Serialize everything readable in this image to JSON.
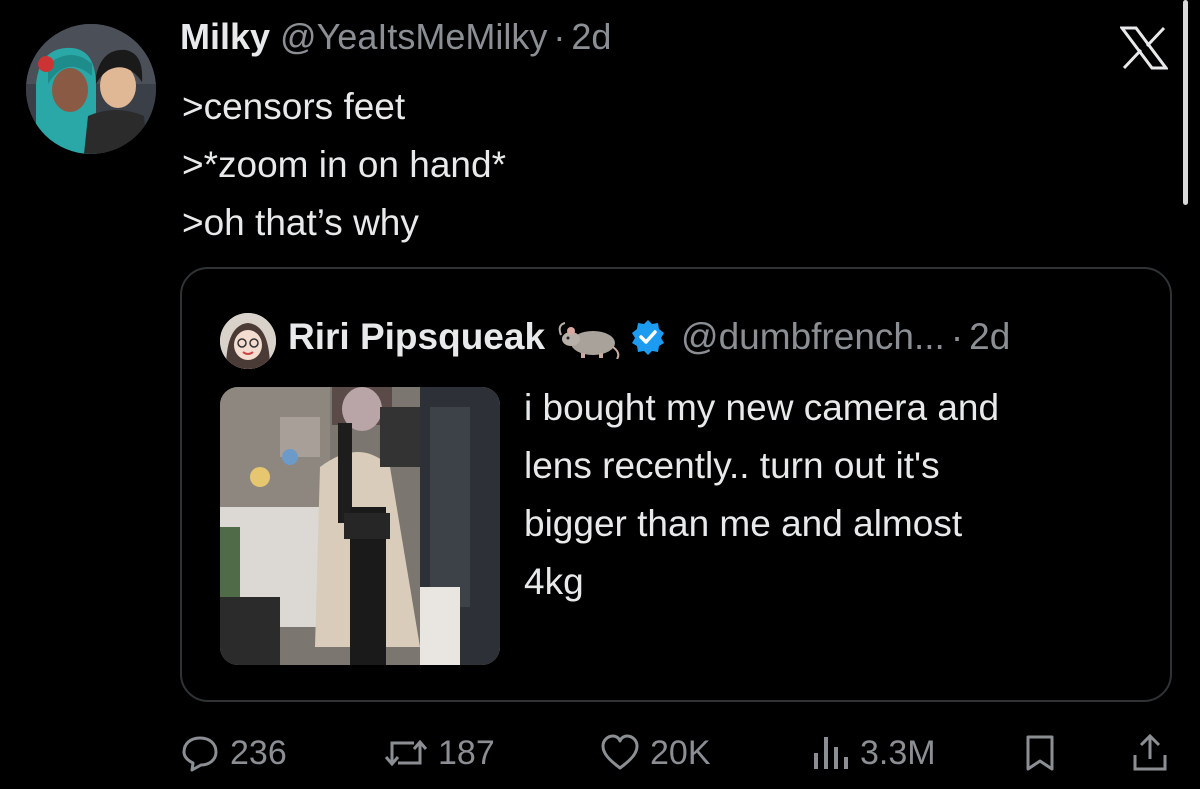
{
  "tweet": {
    "display_name": "Milky",
    "handle": "@YeaItsMeMilky",
    "separator": "·",
    "age": "2d",
    "lines": [
      ">censors feet",
      ">*zoom in on hand*",
      ">oh that’s why"
    ]
  },
  "quoted": {
    "display_name": "Riri Pipsqueak",
    "handle": "@dumbfrench...",
    "separator": "·",
    "age": "2d",
    "text": "i bought my new camera and lens recently.. turn out it's bigger than me and almost 4kg",
    "lines": [
      "i bought my new camera and",
      "lens recently.. turn out it's",
      "bigger than me and almost",
      "4kg"
    ]
  },
  "actions": {
    "replies": "236",
    "reposts": "187",
    "likes": "20K",
    "views": "3.3M"
  },
  "icons": [
    "x-logo-icon",
    "rat-icon",
    "verified-badge-icon",
    "reply-icon",
    "repost-icon",
    "like-icon",
    "views-icon",
    "bookmark-icon",
    "share-icon"
  ],
  "colors": {
    "background": "#000000",
    "text": "#e7e9ea",
    "secondary": "#8b8f94",
    "border": "#2f3336",
    "verified": "#1d9bf0"
  }
}
